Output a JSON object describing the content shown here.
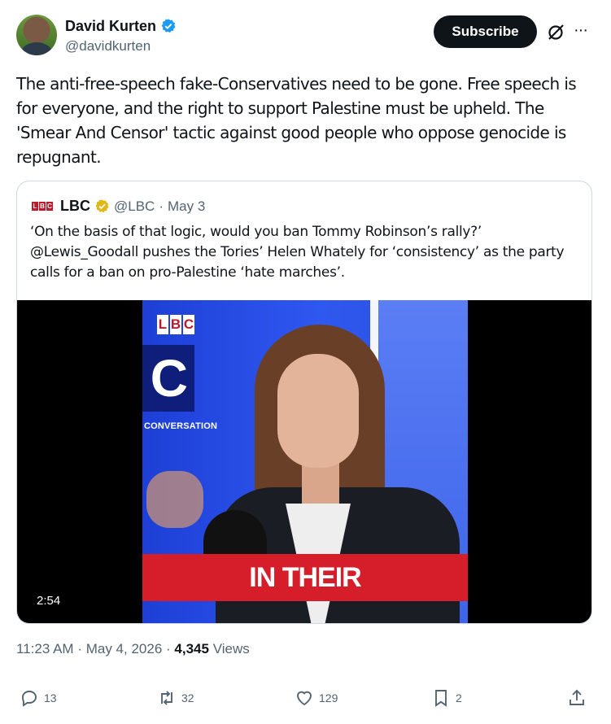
{
  "author": {
    "name": "David Kurten",
    "handle": "@davidkurten"
  },
  "header": {
    "subscribe_label": "Subscribe",
    "more_label": "···"
  },
  "tweet": {
    "text": "The anti-free-speech fake-Conservatives need to be gone. Free speech is for everyone, and the right to support Palestine must be upheld. The 'Smear And Censor' tactic against good people who oppose genocide is repugnant."
  },
  "quote": {
    "logo_letters": [
      "L",
      "B",
      "C"
    ],
    "name": "LBC",
    "handle": "@LBC",
    "separator": "·",
    "date": "May 3",
    "text": "‘On the basis of that logic, would you ban Tommy Robinson’s rally?’ @Lewis_Goodall pushes the Tories’ Helen Whately for ‘consistency’ as the party calls for a ban on pro-Palestine ‘hate marches’.",
    "video": {
      "logo_letters": [
        "L",
        "B",
        "C"
      ],
      "big_letter": "C",
      "conversation_label": "CONVERSATION",
      "caption": "IN THEIR",
      "duration": "2:54"
    }
  },
  "meta": {
    "time": "11:23 AM",
    "separator": "·",
    "date": "May 4, 2026",
    "views_count": "4,345",
    "views_label": "Views"
  },
  "actions": {
    "replies": "13",
    "reposts": "32",
    "likes": "129",
    "bookmarks": "2"
  },
  "colors": {
    "text_primary": "#0f1419",
    "text_secondary": "#536471",
    "verified_blue": "#1d9bf0",
    "verified_gold": "#e2b719",
    "lbc_red": "#d61e2a",
    "border": "#cfd9de"
  },
  "icons": [
    "verified-icon",
    "grok-icon",
    "more-icon",
    "reply-icon",
    "repost-icon",
    "like-icon",
    "bookmark-icon",
    "share-icon"
  ]
}
